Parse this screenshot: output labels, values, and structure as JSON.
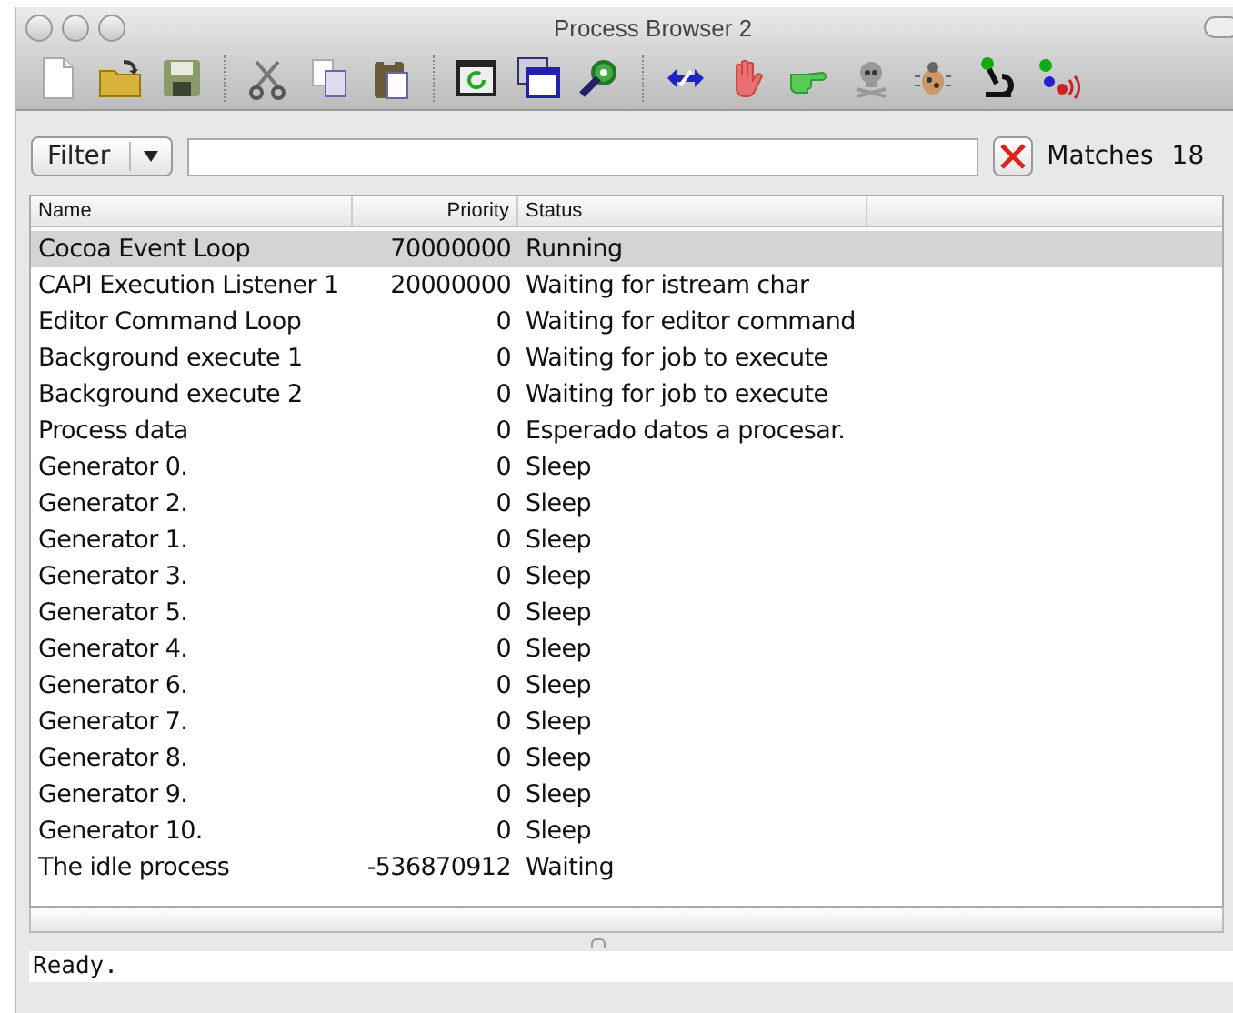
{
  "window": {
    "title": "Process Browser 2"
  },
  "filter": {
    "button": "Filter",
    "matches_label": "Matches",
    "matches_count": "18"
  },
  "table": {
    "columns": [
      "Name",
      "Priority",
      "Status"
    ],
    "rows": [
      {
        "name": "Cocoa Event Loop",
        "priority": "70000000",
        "status": "Running",
        "selected": true
      },
      {
        "name": "CAPI Execution Listener 1",
        "priority": "20000000",
        "status": "Waiting for istream char",
        "selected": false
      },
      {
        "name": "Editor Command Loop",
        "priority": "0",
        "status": "Waiting for editor command",
        "selected": false
      },
      {
        "name": "Background execute 1",
        "priority": "0",
        "status": "Waiting for job to execute",
        "selected": false
      },
      {
        "name": "Background execute 2",
        "priority": "0",
        "status": "Waiting for job to execute",
        "selected": false
      },
      {
        "name": "Process data",
        "priority": "0",
        "status": "Esperado datos a procesar.",
        "selected": false
      },
      {
        "name": "Generator 0.",
        "priority": "0",
        "status": "Sleep",
        "selected": false
      },
      {
        "name": "Generator 2.",
        "priority": "0",
        "status": "Sleep",
        "selected": false
      },
      {
        "name": "Generator 1.",
        "priority": "0",
        "status": "Sleep",
        "selected": false
      },
      {
        "name": "Generator 3.",
        "priority": "0",
        "status": "Sleep",
        "selected": false
      },
      {
        "name": "Generator 5.",
        "priority": "0",
        "status": "Sleep",
        "selected": false
      },
      {
        "name": "Generator 4.",
        "priority": "0",
        "status": "Sleep",
        "selected": false
      },
      {
        "name": "Generator 6.",
        "priority": "0",
        "status": "Sleep",
        "selected": false
      },
      {
        "name": "Generator 7.",
        "priority": "0",
        "status": "Sleep",
        "selected": false
      },
      {
        "name": "Generator 8.",
        "priority": "0",
        "status": "Sleep",
        "selected": false
      },
      {
        "name": "Generator 9.",
        "priority": "0",
        "status": "Sleep",
        "selected": false
      },
      {
        "name": "Generator 10.",
        "priority": "0",
        "status": "Sleep",
        "selected": false
      },
      {
        "name": "The idle process",
        "priority": "-536870912",
        "status": "Waiting",
        "selected": false
      }
    ]
  },
  "status_bar": "Ready."
}
